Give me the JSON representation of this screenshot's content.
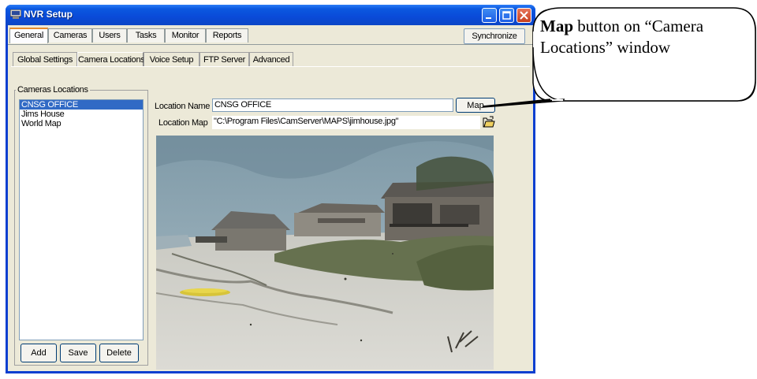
{
  "window": {
    "title": "NVR Setup",
    "accent": "#0a3fd0"
  },
  "main_tabs": [
    {
      "label": "General",
      "active": true
    },
    {
      "label": "Cameras",
      "active": false
    },
    {
      "label": "Users",
      "active": false
    },
    {
      "label": "Tasks",
      "active": false
    },
    {
      "label": "Monitor",
      "active": false
    },
    {
      "label": "Reports",
      "active": false
    }
  ],
  "sync_label": "Synchronize",
  "sub_tabs": [
    {
      "label": "Global Settings",
      "active": false
    },
    {
      "label": "Camera Locations",
      "active": true
    },
    {
      "label": "Voice Setup",
      "active": false
    },
    {
      "label": "FTP Server",
      "active": false
    },
    {
      "label": "Advanced",
      "active": false
    }
  ],
  "locations": {
    "group_label": "Cameras Locations",
    "items": [
      "CNSG OFFICE",
      "Jims House",
      "World Map"
    ],
    "selected": "CNSG OFFICE",
    "add_label": "Add",
    "save_label": "Save",
    "delete_label": "Delete"
  },
  "form": {
    "location_name_label": "Location Name",
    "location_name_value": "CNSG OFFICE",
    "map_button_label": "Map",
    "location_map_label": "Location Map",
    "location_map_value": "\"C:\\Program Files\\CamServer\\MAPS\\jimhouse.jpg\"",
    "browse_icon": "folder-open-icon"
  },
  "callout": {
    "bold": "Map",
    "rest": " button on “Camera Locations” window"
  }
}
